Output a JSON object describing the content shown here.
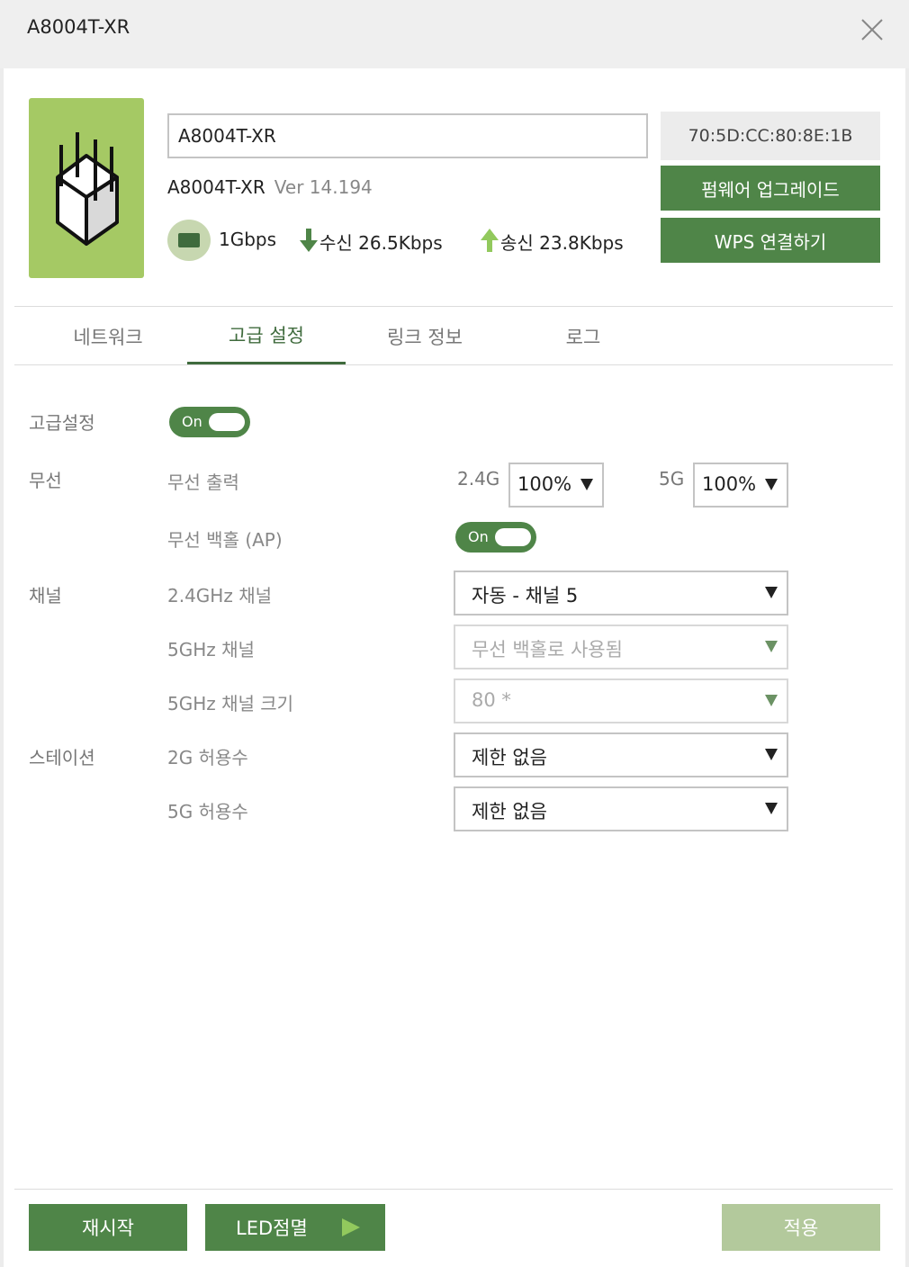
{
  "window": {
    "title": "A8004T-XR"
  },
  "device": {
    "name_value": "A8004T-XR",
    "model": "A8004T-XR",
    "version": "Ver 14.194",
    "link_speed": "1Gbps",
    "rx_label": "수신",
    "rx_value": "26.5Kbps",
    "tx_label": "송신",
    "tx_value": "23.8Kbps",
    "mac": "70:5D:CC:80:8E:1B"
  },
  "actions": {
    "firmware_upgrade": "펌웨어 업그레이드",
    "wps_connect": "WPS 연결하기"
  },
  "tabs": [
    {
      "label": "네트워크"
    },
    {
      "label": "고급 설정"
    },
    {
      "label": "링크 정보"
    },
    {
      "label": "로그"
    }
  ],
  "active_tab": "고급 설정",
  "advanced": {
    "advanced_label": "고급설정",
    "advanced_toggle": "On",
    "wireless_label": "무선",
    "wireless_power_label": "무선 출력",
    "band_24_label": "2.4G",
    "band_24_value": "100%",
    "band_5_label": "5G",
    "band_5_value": "100%",
    "backhaul_label": "무선 백홀 (AP)",
    "backhaul_toggle": "On",
    "channel_label": "채널",
    "ch24_label": "2.4GHz 채널",
    "ch24_value": "자동 - 채널 5",
    "ch5_label": "5GHz 채널",
    "ch5_value": "무선 백홀로 사용됨",
    "ch5_width_label": "5GHz 채널 크기",
    "ch5_width_value": "80 *",
    "station_label": "스테이션",
    "sta2g_label": "2G 허용수",
    "sta2g_value": "제한 없음",
    "sta5g_label": "5G 허용수",
    "sta5g_value": "제한 없음"
  },
  "footer": {
    "restart": "재시작",
    "led_blink": "LED점멸",
    "apply": "적용"
  },
  "colors": {
    "primary": "#4f8548",
    "device_bg": "#a5c964",
    "apply_disabled": "#b3c99c",
    "tab_active": "#3f6b3d"
  }
}
